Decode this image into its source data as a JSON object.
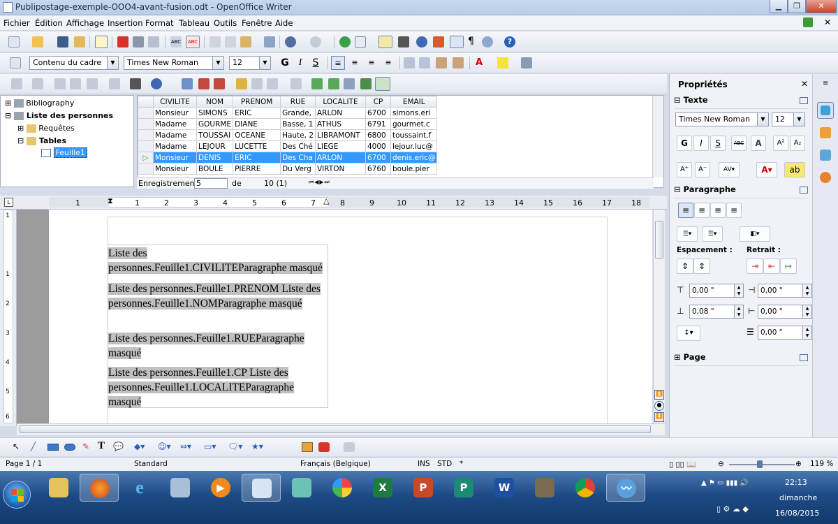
{
  "window": {
    "title": "Publipostage-exemple-OOO4-avant-fusion.odt - OpenOffice Writer",
    "minimize": "▁",
    "maximize": "❐",
    "close": "✕"
  },
  "menu": [
    "Fichier",
    "Édition",
    "Affichage",
    "Insertion",
    "Format",
    "Tableau",
    "Outils",
    "Fenêtre",
    "Aide"
  ],
  "format_toolbar": {
    "style": "Contenu du cadre",
    "font": "Times New Roman",
    "size": "12"
  },
  "tree": {
    "items": [
      {
        "label": "Bibliography",
        "level": 0,
        "bold": false
      },
      {
        "label": "Liste des personnes",
        "level": 0,
        "bold": true
      },
      {
        "label": "Requêtes",
        "level": 1,
        "bold": false
      },
      {
        "label": "Tables",
        "level": 1,
        "bold": true
      },
      {
        "label": "Feuille1",
        "level": 2,
        "bold": false,
        "selected": true
      }
    ]
  },
  "grid": {
    "columns": [
      "CIVILITE",
      "NOM",
      "PRENOM",
      "RUE",
      "LOCALITE",
      "CP",
      "EMAIL"
    ],
    "rows": [
      [
        "Monsieur",
        "SIMONS",
        "ERIC",
        "Grande,",
        "ARLON",
        "6700",
        "simons.eri"
      ],
      [
        "Madame",
        "GOURME",
        "DIANE",
        "Basse, 1",
        "ATHUS",
        "6791",
        "gourmet.c"
      ],
      [
        "Madame",
        "TOUSSAI",
        "OCEANE",
        "Haute, 2",
        "LIBRAMONT",
        "6800",
        "toussaint.f"
      ],
      [
        "Madame",
        "LEJOUR",
        "LUCETTE",
        "Des Ché",
        "LIEGE",
        "4000",
        "lejour.luc@"
      ],
      [
        "Monsieur",
        "DENIS",
        "ERIC",
        "Des Cha",
        "ARLON",
        "6700",
        "denis.eric@"
      ],
      [
        "Monsieur",
        "BOULE",
        "PIERRE",
        "Du Verg",
        "VIRTON",
        "6760",
        "boule.pier"
      ]
    ],
    "selected_row": 4
  },
  "record_nav": {
    "label": "Enregistrement",
    "current": "5",
    "of_label": "de",
    "total": "10 (1)"
  },
  "ruler": [
    "1",
    "1",
    "2",
    "3",
    "4",
    "5",
    "6",
    "7",
    "8",
    "9",
    "10",
    "11",
    "12",
    "13",
    "14",
    "15",
    "16",
    "17",
    "18"
  ],
  "vruler": [
    "1",
    "1",
    "2",
    "3",
    "4",
    "5",
    "6"
  ],
  "document": {
    "paragraphs": [
      "Liste des personnes.Feuille1.CIVILITEParagraphe masqué",
      "Liste des personnes.Feuille1.PRENOM Liste des personnes.Feuille1.NOMParagraphe masqué",
      "Liste des personnes.Feuille1.RUEParagraphe masqué",
      "Liste des personnes.Feuille1.CP Liste des personnes.Feuille1.LOCALITEParagraphe masqué"
    ]
  },
  "sidebar": {
    "title": "Propriétés",
    "text_section": "Texte",
    "font": "Times New Roman",
    "size": "12",
    "paragraph_section": "Paragraphe",
    "spacing_label": "Espacement :",
    "indent_label": "Retrait :",
    "above": "0,00 \"",
    "below": "0,08 \"",
    "indent_before": "0,00 \"",
    "indent_after": "0,00 \"",
    "first_line": "0,00 \"",
    "page_section": "Page"
  },
  "status": {
    "page": "Page 1 / 1",
    "style": "Standard",
    "language": "Français (Belgique)",
    "ins": "INS",
    "std": "STD",
    "mod": "*",
    "zoom": "119 %"
  },
  "taskbar": {
    "time": "22:13",
    "day": "dimanche",
    "date": "16/08/2015"
  }
}
